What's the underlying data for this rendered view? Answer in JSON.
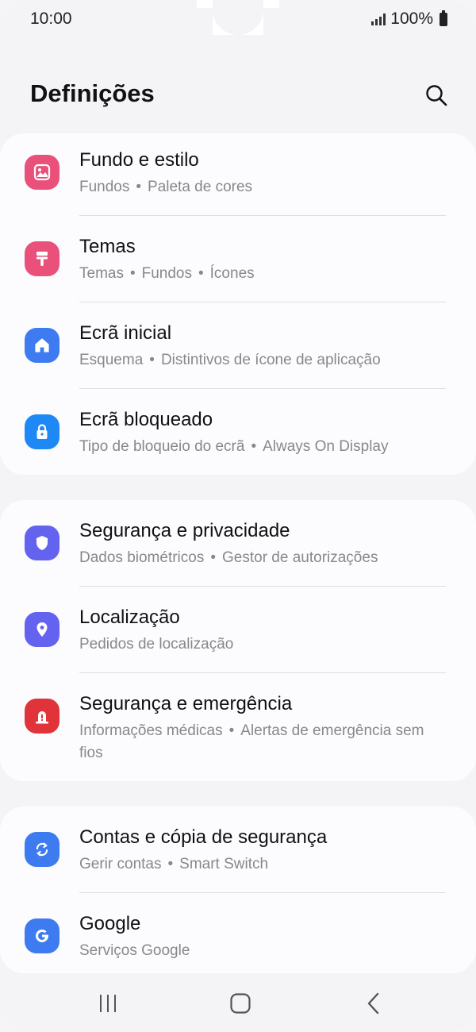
{
  "status": {
    "time": "10:00",
    "battery": "100%"
  },
  "header": {
    "title": "Definições"
  },
  "colors": {
    "pink": "#e9507a",
    "blue": "#3e7bf0",
    "lock_blue": "#1e88f5",
    "purple": "#6463f0",
    "red": "#e0343a"
  },
  "cards": [
    {
      "items": [
        {
          "title": "Fundo e estilo",
          "sub": [
            "Fundos",
            "Paleta de cores"
          ],
          "icon": "wallpaper-icon"
        },
        {
          "title": "Temas",
          "sub": [
            "Temas",
            "Fundos",
            "Ícones"
          ],
          "icon": "themes-brush-icon"
        },
        {
          "title": "Ecrã inicial",
          "sub": [
            "Esquema",
            "Distintivos de ícone de aplicação"
          ],
          "icon": "home-icon"
        },
        {
          "title": "Ecrã bloqueado",
          "sub": [
            "Tipo de bloqueio do ecrã",
            "Always On Display"
          ],
          "icon": "lock-icon"
        }
      ]
    },
    {
      "items": [
        {
          "title": "Segurança e privacidade",
          "sub": [
            "Dados biométricos",
            "Gestor de autorizações"
          ],
          "icon": "shield-icon"
        },
        {
          "title": "Localização",
          "sub": [
            "Pedidos de localização"
          ],
          "icon": "location-pin-icon"
        },
        {
          "title": "Segurança e emergência",
          "sub": [
            "Informações médicas",
            "Alertas de emergência sem fios"
          ],
          "icon": "emergency-icon"
        }
      ]
    },
    {
      "items": [
        {
          "title": "Contas e cópia de segurança",
          "sub": [
            "Gerir contas",
            "Smart Switch"
          ],
          "icon": "sync-icon"
        },
        {
          "title": "Google",
          "sub": [
            "Serviços Google"
          ],
          "icon": "google-icon"
        }
      ]
    }
  ],
  "navbar": {
    "recents": "recents-icon",
    "home": "home-button-icon",
    "back": "back-icon"
  }
}
